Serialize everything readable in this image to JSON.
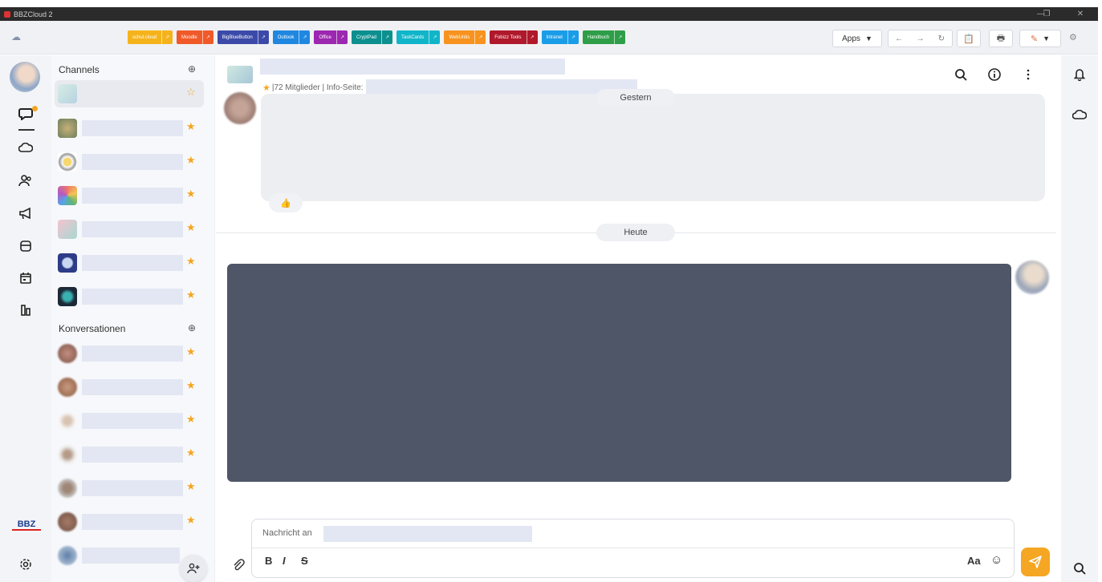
{
  "window": {
    "title": "BBZCloud 2",
    "controls": [
      "—",
      "❐",
      "✕"
    ]
  },
  "bookmarks": [
    {
      "label": "schul.cloud",
      "color": "#f5b31b"
    },
    {
      "label": "Moodle",
      "color": "#f05a28"
    },
    {
      "label": "BigBlueButton",
      "color": "#3b4aa8"
    },
    {
      "label": "Outlook",
      "color": "#1f87e0"
    },
    {
      "label": "Office",
      "color": "#9c27b0"
    },
    {
      "label": "CryptPad",
      "color": "#0c8f8f"
    },
    {
      "label": "TaskCards",
      "color": "#10b5c9"
    },
    {
      "label": "WebUntis",
      "color": "#f7931e"
    },
    {
      "label": "Fobizz Tools",
      "color": "#b0182b"
    },
    {
      "label": "Intranet",
      "color": "#1a9de8"
    },
    {
      "label": "Handbuch",
      "color": "#2e9e48"
    }
  ],
  "bookmark_arrow": "↗",
  "toolbar": {
    "apps_label": "Apps",
    "apps_caret": "▼",
    "back": "←",
    "forward": "→",
    "reload": "↻",
    "notes": "📋",
    "print": "🖶",
    "edit": "✎",
    "edit_caret": "▼",
    "settings": "⚙"
  },
  "rail": {
    "logo_text": "BBZ",
    "icons": [
      "chat-icon",
      "cloud-icon",
      "contacts-icon",
      "megaphone-icon",
      "archive-icon",
      "calendar-icon",
      "stats-icon",
      "settings-icon"
    ]
  },
  "sidebar": {
    "channels_title": "Channels",
    "add_symbol": "⊕",
    "conversations_title": "Konversationen",
    "star": "★",
    "active_star": "☆"
  },
  "chat": {
    "member_info": "|72 Mitglieder | Info-Seite:",
    "day1": "Gestern",
    "day2": "Heute",
    "reaction": "👍",
    "composer_placeholder": "Nachricht an",
    "format_bold": "B",
    "format_italic": "I",
    "format_strike": "S",
    "text_size": "Aa",
    "emoji": "☺"
  }
}
